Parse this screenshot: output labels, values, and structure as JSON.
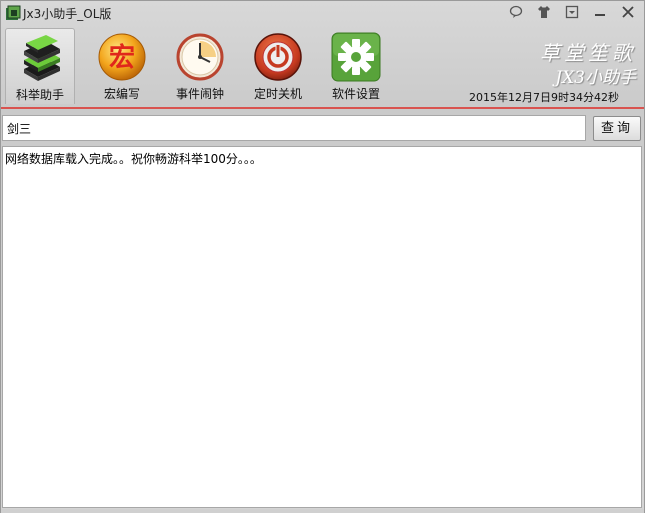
{
  "window": {
    "title": "Jx3小助手_OL版"
  },
  "toolbar": {
    "items": [
      {
        "label": "科举助手",
        "icon": "books-icon",
        "active": true
      },
      {
        "label": "宏编写",
        "icon": "macro-icon",
        "glyph": "宏"
      },
      {
        "label": "事件闹钟",
        "icon": "clock-icon"
      },
      {
        "label": "定时关机",
        "icon": "power-icon"
      },
      {
        "label": "软件设置",
        "icon": "gear-icon"
      }
    ]
  },
  "brand": {
    "line1": "草堂笙歌",
    "line2": "JX3小助手"
  },
  "datetime": "2015年12月7日9时34分42秒",
  "search": {
    "value": "剑三",
    "button_label": "查询"
  },
  "output": {
    "text": "网络数据库载入完成。。祝你畅游科举100分。。。"
  },
  "colors": {
    "accent_line": "#d9534f",
    "macro_red": "#e0271b",
    "power_red": "#c63a20",
    "gear_green": "#58a33a"
  }
}
